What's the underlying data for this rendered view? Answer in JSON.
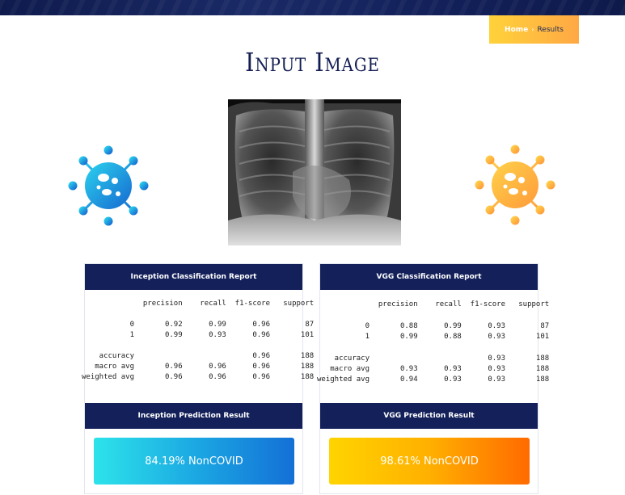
{
  "breadcrumb": {
    "home": "Home",
    "separator": "›",
    "current": "Results"
  },
  "page_title": "Input Image",
  "inception": {
    "report_title": "Inception Classification Report",
    "report_lines": [
      "              precision    recall  f1-score   support",
      "",
      "           0       0.92      0.99      0.96        87",
      "           1       0.99      0.93      0.96       101",
      "",
      "    accuracy                           0.96       188",
      "   macro avg       0.96      0.96      0.96       188",
      "weighted avg       0.96      0.96      0.96       188"
    ],
    "prediction_title": "Inception Prediction Result",
    "prediction": "84.19% NonCOVID"
  },
  "vgg": {
    "report_title": "VGG Classification Report",
    "report_lines": [
      "              precision    recall  f1-score   support",
      "",
      "           0       0.88      0.99      0.93        87",
      "           1       0.99      0.88      0.93       101",
      "",
      "    accuracy                           0.93       188",
      "   macro avg       0.93      0.93      0.93       188",
      "weighted avg       0.94      0.93      0.93       188"
    ],
    "prediction_title": "VGG Prediction Result",
    "prediction": "98.61% NonCOVID"
  },
  "colors": {
    "navy": "#13205a",
    "orange": "#ffa845",
    "blue": "#1aa3e2"
  },
  "icons": {
    "left": "virus-icon",
    "right": "virus-icon"
  }
}
